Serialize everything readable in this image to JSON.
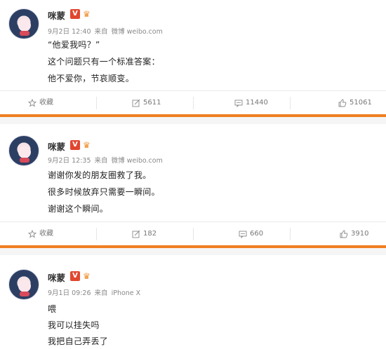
{
  "colors": {
    "accent": "#f07f21",
    "vbadge": "#e0462f",
    "crown": "#f08d2c"
  },
  "posts": [
    {
      "username": "咪蒙",
      "vbadge": "V",
      "crown": "♛",
      "date": "9月2日 12:40",
      "via": "来自",
      "source": "微博 weibo.com",
      "lines": [
        "“他爱我吗？”",
        "这个问题只有一个标准答案：",
        "他不爱你，节哀顺变。"
      ],
      "actions": {
        "favorite": "收藏",
        "repost": "5611",
        "comment": "11440",
        "like": "51061"
      }
    },
    {
      "username": "咪蒙",
      "vbadge": "V",
      "crown": "♛",
      "date": "9月2日 12:35",
      "via": "来自",
      "source": "微博 weibo.com",
      "lines": [
        "谢谢你发的朋友圈救了我。",
        "很多时候放弃只需要一瞬间。",
        "谢谢这个瞬间。"
      ],
      "actions": {
        "favorite": "收藏",
        "repost": "182",
        "comment": "660",
        "like": "3910"
      }
    },
    {
      "username": "咪蒙",
      "vbadge": "V",
      "crown": "♛",
      "date": "9月1日 09:26",
      "via": "来自",
      "source": "iPhone X",
      "lines": [
        "喂",
        "我可以挂失吗",
        "我把自己弄丢了"
      ]
    }
  ],
  "icons": {
    "favorite": "star-icon",
    "repost": "repost-icon",
    "comment": "comment-icon",
    "like": "thumbs-up-icon"
  }
}
